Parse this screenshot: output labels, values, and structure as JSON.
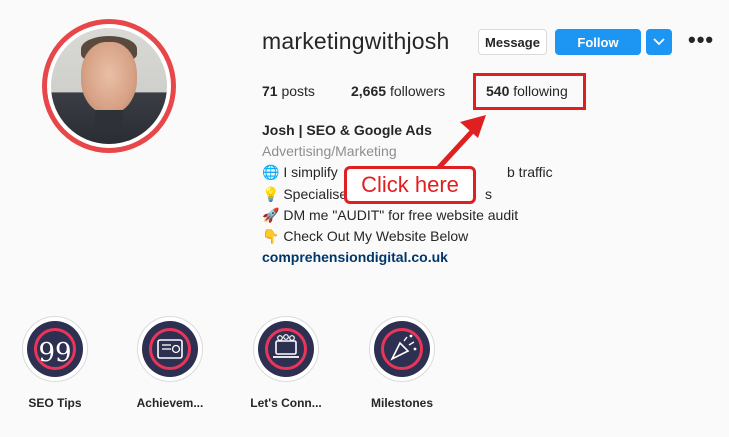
{
  "profile": {
    "username": "marketingwithjosh",
    "message_label": "Message",
    "follow_label": "Follow",
    "dropdown_icon": "chevron-down-icon",
    "more_label": "•••"
  },
  "stats": {
    "posts_count": "71",
    "posts_label": "posts",
    "followers_count": "2,665",
    "followers_label": "followers",
    "following_count": "540",
    "following_label": "following"
  },
  "bio": {
    "name": "Josh | SEO & Google Ads",
    "category": "Advertising/Marketing",
    "lines": [
      {
        "icon": "🌐",
        "text": "I simplify",
        "tail": "b traffic"
      },
      {
        "icon": "💡",
        "text": "Specialise",
        "tail": "s"
      },
      {
        "icon": "🚀",
        "text": "DM me \"AUDIT\" for free website audit"
      },
      {
        "icon": "👇",
        "text": "Check Out My Website Below"
      }
    ],
    "link": "comprehensiondigital.co.uk"
  },
  "annotation": {
    "callout_text": "Click here",
    "color": "#e02020"
  },
  "highlights": [
    {
      "label": "SEO Tips",
      "icon": "quote-icon"
    },
    {
      "label": "Achievem...",
      "icon": "certificate-icon"
    },
    {
      "label": "Let's Conn...",
      "icon": "laptop-icon"
    },
    {
      "label": "Milestones",
      "icon": "party-popper-icon"
    }
  ],
  "colors": {
    "follow_blue": "#1d95f3",
    "link_blue": "#00376b",
    "ring_red": "#e8474a",
    "highlight_bg": "#2d3050"
  }
}
